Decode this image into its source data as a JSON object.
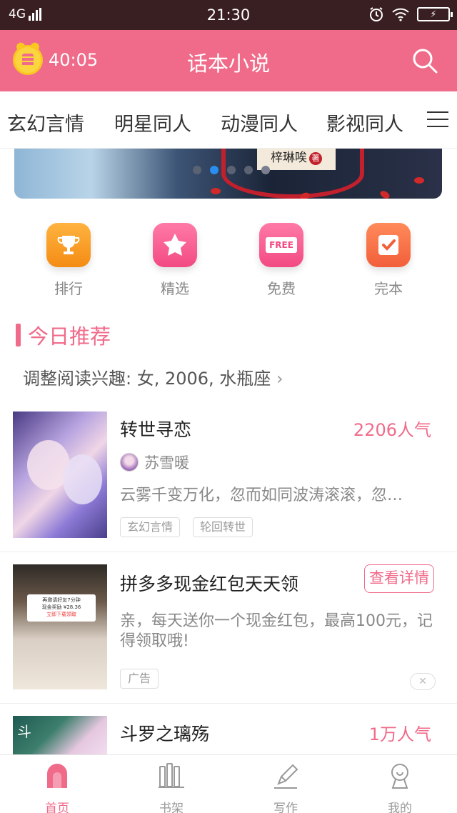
{
  "status_bar": {
    "network": "4G",
    "time": "21:30"
  },
  "header": {
    "timer": "40:05",
    "title": "话本小说"
  },
  "category_tabs": [
    "玄幻言情",
    "明星同人",
    "动漫同人",
    "影视同人"
  ],
  "banner": {
    "author": "梓琳唉",
    "seal": "著",
    "active_dot_index": 1
  },
  "quick_entries": [
    {
      "label": "排行",
      "icon": "trophy-icon"
    },
    {
      "label": "精选",
      "icon": "star-icon"
    },
    {
      "label": "免费",
      "icon": "free-tag-icon",
      "badge": "FREE"
    },
    {
      "label": "完本",
      "icon": "checkmark-icon"
    }
  ],
  "section": {
    "title": "今日推荐",
    "interest_prefs": "调整阅读兴趣: 女, 2006, 水瓶座"
  },
  "feed": [
    {
      "title": "转世寻恋",
      "popularity": "2206人气",
      "author": "苏雪暖",
      "description": "云雾千变万化，忽而如同波涛滚滚，忽…",
      "tags": [
        "玄幻言情",
        "轮回转世"
      ]
    },
    {
      "title": "拼多多现金红包天天领",
      "cta": "查看详情",
      "description": "亲，每天送你一个现金红包，最高100元，记得领取哦!",
      "ad_label": "广告",
      "cover_card": {
        "line1": "再邀请好友7分钟",
        "line2": "现金奖励 ¥28.36",
        "button": "立即下载领取"
      }
    },
    {
      "title": "斗罗之璃殇",
      "popularity": "1万人气"
    }
  ],
  "bottom_tabs": [
    {
      "label": "首页",
      "icon": "home-icon",
      "active": true
    },
    {
      "label": "书架",
      "icon": "bookshelf-icon"
    },
    {
      "label": "写作",
      "icon": "pencil-icon"
    },
    {
      "label": "我的",
      "icon": "profile-icon"
    }
  ],
  "colors": {
    "primary": "#f06b8a",
    "status_bar": "#3a1f22",
    "alarm_gold": "#fbd53f"
  }
}
